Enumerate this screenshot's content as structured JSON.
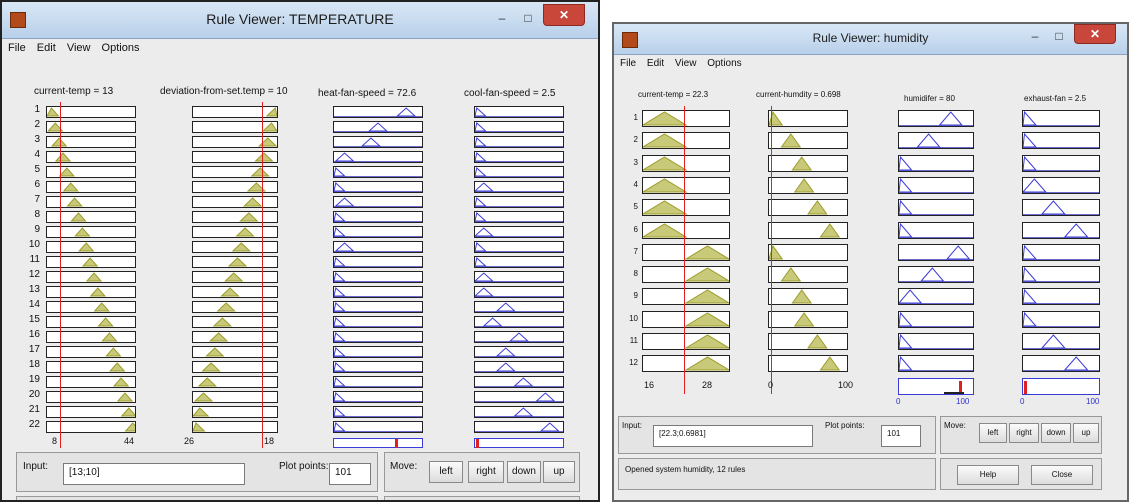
{
  "temperature_window": {
    "title": "Rule Viewer: TEMPERATURE",
    "window_buttons": {
      "minimize": "–",
      "maximize": "□",
      "close": "✕"
    },
    "menu": [
      "File",
      "Edit",
      "View",
      "Options"
    ],
    "variables": [
      {
        "label": "current-temp = 13"
      },
      {
        "label": "deviation-from-set.temp = 10"
      },
      {
        "label": "heat-fan-speed = 72.6"
      },
      {
        "label": "cool-fan-speed = 2.5"
      }
    ],
    "rule_numbers": [
      "1",
      "2",
      "3",
      "4",
      "5",
      "6",
      "7",
      "8",
      "9",
      "10",
      "11",
      "12",
      "13",
      "14",
      "15",
      "16",
      "17",
      "18",
      "19",
      "20",
      "21",
      "22"
    ],
    "axis_ticks": [
      [
        "8",
        "44"
      ],
      [
        "26",
        "18"
      ]
    ],
    "input_label": "Input:",
    "input_value": "[13;10]",
    "plot_points_label": "Plot points:",
    "plot_points_value": "101",
    "move_label": "Move:",
    "move_buttons": [
      "left",
      "right",
      "down",
      "up"
    ],
    "red_line_values": {
      "current_temp": 13,
      "deviation": 10
    },
    "output_values": {
      "heat_fan_speed": 72.6,
      "cool_fan_speed": 2.5
    }
  },
  "humidity_window": {
    "title": "Rule Viewer: humidity",
    "window_buttons": {
      "minimize": "–",
      "maximize": "□",
      "close": "✕"
    },
    "menu": [
      "File",
      "Edit",
      "View",
      "Options"
    ],
    "variables": [
      {
        "label": "current-temp = 22.3"
      },
      {
        "label": "current-humdity = 0.698"
      },
      {
        "label": "humidifer = 80"
      },
      {
        "label": "exhaust-fan = 2.5"
      }
    ],
    "rule_numbers": [
      "1",
      "2",
      "3",
      "4",
      "5",
      "6",
      "7",
      "8",
      "9",
      "10",
      "11",
      "12"
    ],
    "axis_ticks": [
      [
        "16",
        "28"
      ],
      [
        "0",
        "100"
      ]
    ],
    "output_axis_ticks": [
      [
        "0",
        "100"
      ],
      [
        "0",
        "100"
      ]
    ],
    "input_label": "Input:",
    "input_value": "[22.3;0.6981]",
    "plot_points_label": "Plot points:",
    "plot_points_value": "101",
    "move_label": "Move:",
    "move_buttons": [
      "left",
      "right",
      "down",
      "up"
    ],
    "status_text": "Opened system humidity, 12 rules",
    "help_label": "Help",
    "close_label": "Close",
    "output_values": {
      "humidifer": 80,
      "exhaust_fan": 2.5
    }
  }
}
